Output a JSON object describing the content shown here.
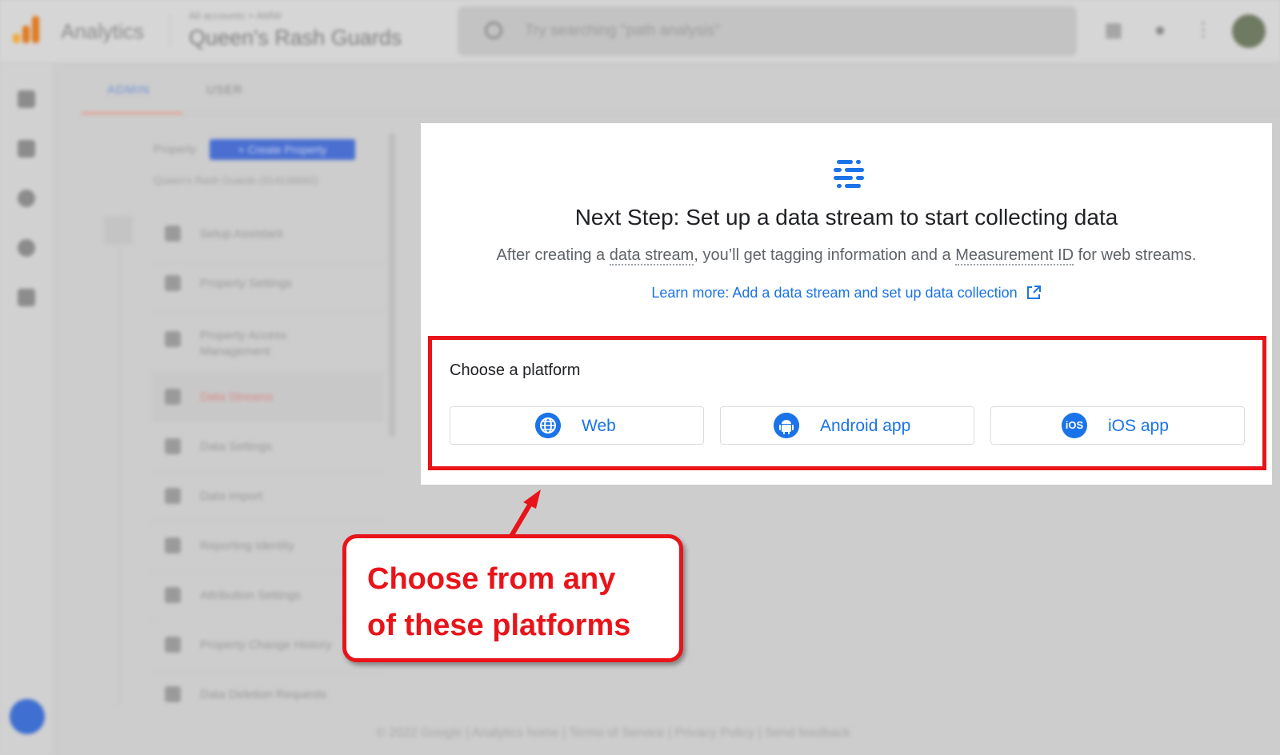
{
  "app": {
    "name": "Analytics",
    "breadcrumb": "All accounts > AMW",
    "property_name": "Queen's Rash Guards",
    "search_placeholder": "Try searching \"path analysis\""
  },
  "tabs": [
    {
      "label": "ADMIN"
    },
    {
      "label": "USER"
    }
  ],
  "property_header": {
    "label": "Property",
    "create_button": "+ Create Property",
    "property_id": "Queen's Rash Guards (314148692)"
  },
  "menu": [
    {
      "label": "Setup Assistant"
    },
    {
      "label": "Property Settings"
    },
    {
      "label": "Property Access Management"
    },
    {
      "label": "Data Streams"
    },
    {
      "label": "Data Settings"
    },
    {
      "label": "Data Import"
    },
    {
      "label": "Reporting Identity"
    },
    {
      "label": "Attribution Settings"
    },
    {
      "label": "Property Change History"
    },
    {
      "label": "Data Deletion Requests"
    }
  ],
  "footer": "© 2022 Google | Analytics home | Terms of Service | Privacy Policy | Send feedback",
  "panel": {
    "title": "Next Step: Set up a data stream to start collecting data",
    "subtitle_part1": "After creating a ",
    "subtitle_term1": "data stream",
    "subtitle_part2": ", you’ll get tagging information and a ",
    "subtitle_term2": "Measurement ID",
    "subtitle_part3": " for web streams.",
    "learn_more": "Learn more: Add a data stream and set up data collection",
    "choose_label": "Choose a platform",
    "platforms": [
      {
        "label": "Web",
        "icon": "globe-icon"
      },
      {
        "label": "Android app",
        "icon": "android-icon"
      },
      {
        "label": "iOS app",
        "icon": "ios-icon",
        "icon_text": "iOS"
      }
    ]
  },
  "callout": {
    "line1": "Choose from any",
    "line2": "of these platforms"
  },
  "colors": {
    "accent_blue": "#1a73e8",
    "annotation_red": "#e8141a"
  }
}
